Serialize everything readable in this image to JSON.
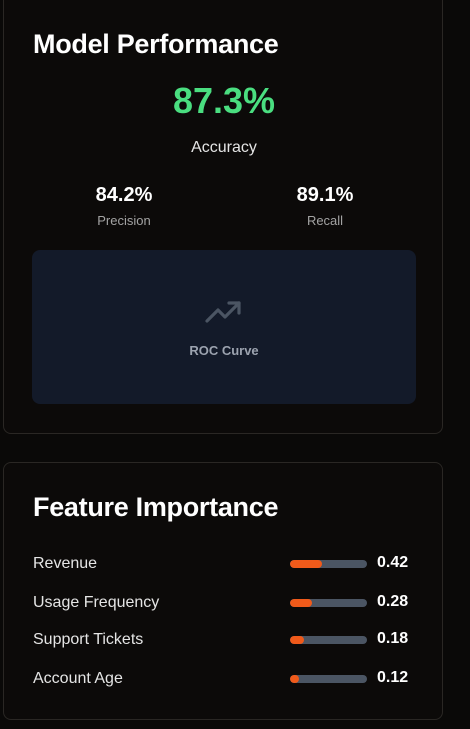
{
  "performance": {
    "title": "Model Performance",
    "accuracy": {
      "value": "87.3%",
      "label": "Accuracy"
    },
    "precision": {
      "value": "84.2%",
      "label": "Precision"
    },
    "recall": {
      "value": "89.1%",
      "label": "Recall"
    },
    "roc": {
      "label": "ROC Curve",
      "icon": "trending-up-icon"
    },
    "colors": {
      "accuracy": "#4ade80"
    }
  },
  "features": {
    "title": "Feature Importance",
    "items": [
      {
        "name": "Revenue",
        "value": "0.42",
        "level": 0.42
      },
      {
        "name": "Usage Frequency",
        "value": "0.28",
        "level": 0.28
      },
      {
        "name": "Support Tickets",
        "value": "0.18",
        "level": 0.18
      },
      {
        "name": "Account Age",
        "value": "0.12",
        "level": 0.12
      }
    ],
    "colors": {
      "bar_fill": "#f05a1a",
      "bar_track": "#4b5563"
    }
  }
}
